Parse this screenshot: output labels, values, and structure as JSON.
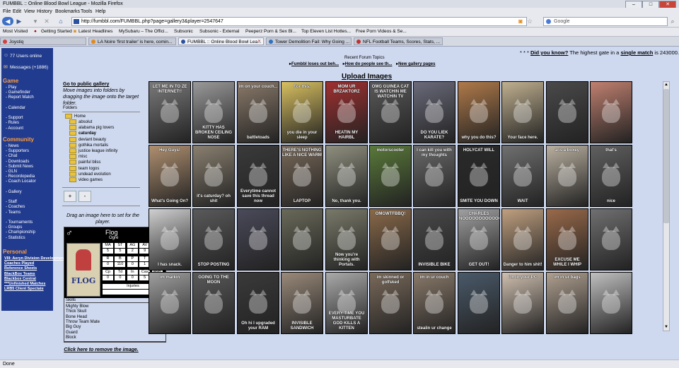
{
  "browser": {
    "title": "FUMBBL :: Online Blood Bowl League - Mozilla Firefox",
    "menu": [
      "File",
      "Edit",
      "View",
      "History",
      "Bookmarks",
      "Tools",
      "Help"
    ],
    "url": "http://fumbbl.com/FUMBBL.php?page=gallery3&player=2547647",
    "search_placeholder": "Google",
    "bookmarks": [
      "Most Visited",
      "Getting Started",
      "Latest Headlines",
      "MySubaru – The Offici...",
      "Subsonic",
      "Subsonic - External",
      "Peeperz Porn & Sex Bl...",
      "Top Eleven List Hottes...",
      "Free Porn Videos & Se..."
    ],
    "tabs": [
      {
        "label": "Joystiq",
        "active": false,
        "color": "#d04040"
      },
      {
        "label": "LA Noire 'first trailer' is here, comin...",
        "active": false,
        "color": "#e08a20"
      },
      {
        "label": "FUMBBL :: Online Blood Bowl Lea...",
        "active": true,
        "color": "#2a50a0"
      },
      {
        "label": "Tower Demolition Fail: Why Going ...",
        "active": false,
        "color": "#3070c0"
      },
      {
        "label": "NFL Football Teams, Scores, Stats, ...",
        "active": false,
        "color": "#c03030"
      }
    ],
    "status": "Done"
  },
  "sidebar": {
    "users_online": "77 Users online",
    "messages": "Messages (+1886)",
    "sections": [
      {
        "title": "Game",
        "items": [
          "- Play",
          "- Gamefinder",
          "- Report Match",
          "",
          "- Calendar",
          "",
          "- Support",
          "- Rules",
          "- Account"
        ]
      },
      {
        "title": "Community",
        "items": [
          "- News",
          "- Supporters",
          "- Chat",
          "- Downloads",
          "- Submit News",
          "- GLN",
          "- Recordopedia",
          "- Coach Locator",
          "",
          "- Gallery",
          "",
          "- Staff",
          "- Coaches",
          "- Teams",
          "",
          "- Tournaments",
          "- Groups",
          "- Championship",
          "- Statistics"
        ]
      },
      {
        "title": "Personal",
        "items": [
          "VIII: Aeryn Division Development",
          "Coaches Played",
          "Reference Sheets",
          "BlackBox Teams",
          "Blackbox Central",
          "***Unfinished Matches",
          "LRB5 Client Spectate"
        ]
      }
    ]
  },
  "top": {
    "did_you_know_prefix": "* * * ",
    "did_you_know_link": "Did you know?",
    "did_you_know_text": " The highest gate in a ",
    "single_match": "single match",
    "did_you_know_suffix": " is 243000.",
    "recent_topics": "Recent Forum Topics",
    "topic1": "Fumbbl loses out beh...",
    "topic2": "How do people see th...",
    "topic3": "New gallery pages"
  },
  "left_panel": {
    "public_gallery_link": "Go to public gallery",
    "instructions": "Move images into folders by dragging the image onto the target folder.",
    "folders_label": "Folders",
    "home": "Home",
    "folders": [
      "absolut",
      "alabama pig lovers",
      "caturday",
      "deviant beauty",
      "gothika mortalis",
      "justice league infinity",
      "misc",
      "painful bliss",
      "team logos",
      "undead evolution",
      "video games"
    ],
    "add_btn": "+",
    "remove_btn": "-",
    "drag_hint": "Drag an image here to set for the player.",
    "click_remove": "Click here to remove the image."
  },
  "player_card": {
    "name": "Flog",
    "position": "Ogre",
    "number": "#1",
    "stats_headers": [
      "MA",
      "ST",
      "AG",
      "AV",
      "G"
    ],
    "stats_values": [
      "5",
      "5",
      "2",
      "9",
      "33"
    ],
    "spp_headers": [
      "R",
      "B",
      "P",
      "T",
      "S"
    ],
    "spp_values": [
      "0",
      "110",
      "0",
      "1",
      "30"
    ],
    "extra_headers": [
      "Cp",
      "Td",
      "In",
      "Cas",
      "Mvp"
    ],
    "extra_values": [
      "0",
      "0",
      "0",
      "5",
      "4"
    ],
    "injuries_label": "Injuries",
    "skills_label": "Skills",
    "skills": [
      "Mighty Blow",
      "Thick Skull",
      "Bone Head",
      "Throw Team Mate",
      "Big Guy",
      "Guard",
      "Block"
    ],
    "box_art": "FLOG"
  },
  "upload": {
    "title": "Upload Images"
  },
  "gallery": [
    {
      "top": "LET ME IN TO ZE INTERNET!!",
      "bot": "",
      "color": "#7a7a7a"
    },
    {
      "top": "",
      "bot": "KITTY HAS BROKEN CEILING NOSE",
      "color": "#9a9a9a"
    },
    {
      "top": "im on your couch...",
      "bot": "battletoads",
      "color": "#8a7a6a"
    },
    {
      "top": "For this,",
      "bot": "you die in your sleep",
      "color": "#d8c060"
    },
    {
      "top": "MOM UR BRZAKTORZ",
      "bot": "HEATIN MY HAIRBL",
      "color": "#a03030"
    },
    {
      "top": "OMG GUINEA CAT IS WATCHIN ME WATCHIN TV",
      "bot": "",
      "color": "#5a5a5a"
    },
    {
      "top": "",
      "bot": "DO YOU LIEK KARATE?",
      "color": "#6a6a7a"
    },
    {
      "top": "",
      "bot": "why you do this?",
      "color": "#b07a4a"
    },
    {
      "top": "",
      "bot": "Your face here.",
      "color": "#c0b090"
    },
    {
      "top": "",
      "bot": "",
      "color": "#4a4a4a"
    },
    {
      "top": "",
      "bot": "",
      "color": "#c08070"
    },
    {
      "top": "Hey Guys!",
      "bot": "What's Going On?",
      "color": "#b09070"
    },
    {
      "top": "",
      "bot": "it's caturday? oh shit",
      "color": "#8a8070"
    },
    {
      "top": "",
      "bot": "Everytime cannot save this thread now",
      "color": "#3a3a3a"
    },
    {
      "top": "THERE'S NOTHING LIKE A NICE WARM",
      "bot": "LAPTOP",
      "color": "#7a6a5a"
    },
    {
      "top": "",
      "bot": "No, thank you.",
      "color": "#909080"
    },
    {
      "top": "motorscooter",
      "bot": "",
      "color": "#5a7a3a"
    },
    {
      "top": "I can kill you with my thoughts",
      "bot": "",
      "color": "#6a6a6a"
    },
    {
      "top": "HOLYCAT WILL",
      "bot": "SMITE YOU DOWN",
      "color": "#2a2a2a"
    },
    {
      "top": "",
      "bot": "WAIT",
      "color": "#707070"
    },
    {
      "top": "a is a boxey",
      "bot": "",
      "color": "#bab0a0"
    },
    {
      "top": "that's",
      "bot": "nice",
      "color": "#606060"
    },
    {
      "top": "",
      "bot": "I has snack.",
      "color": "#d0d0d0"
    },
    {
      "top": "",
      "bot": "STOP POSTING",
      "color": "#5a5a5a"
    },
    {
      "top": "",
      "bot": "",
      "color": "#4a4a5a"
    },
    {
      "top": "",
      "bot": "",
      "color": "#6a6a5a"
    },
    {
      "top": "",
      "bot": "Now you're thinking with Portals.",
      "color": "#7a7a6a"
    },
    {
      "top": "OMGWTFBBQ!",
      "bot": "",
      "color": "#8a6a4a"
    },
    {
      "top": "",
      "bot": "INVISIBLE BIKE",
      "color": "#4a4a4a"
    },
    {
      "top": "CHARLES NOOOOOOOOOOOO!",
      "bot": "GET OUT!",
      "color": "#a0a0a0"
    },
    {
      "top": "",
      "bot": "Danger to him shit!",
      "color": "#c0a080"
    },
    {
      "top": "",
      "bot": "EXCUSE ME WHILE I WHIP",
      "color": "#9a6a4a"
    },
    {
      "top": "",
      "bot": "",
      "color": "#707070"
    },
    {
      "top": "im markin",
      "bot": "",
      "color": "#a0a0a0"
    },
    {
      "top": "GOING TO THE MOON",
      "bot": "",
      "color": "#5a5a5a"
    },
    {
      "top": "",
      "bot": "Oh hi I upgraded your RAM",
      "color": "#3a3a3a"
    },
    {
      "top": "",
      "bot": "INVISIBLE SANDWICH",
      "color": "#9a8a7a"
    },
    {
      "top": "",
      "bot": "EVERY TIME YOU MASTURBATE GOD KILLS A KITTEN",
      "color": "#aaaaaa"
    },
    {
      "top": "im skinned or golfsked",
      "bot": "",
      "color": "#7a6a5a"
    },
    {
      "top": "im in ur couch",
      "bot": "stealin ur change",
      "color": "#8a7a6a"
    },
    {
      "top": "",
      "bot": "",
      "color": "#4a5a6a"
    },
    {
      "top": "I'm in your PC",
      "bot": "",
      "color": "#d0c0b0"
    },
    {
      "top": "im in ur bags",
      "bot": "",
      "color": "#b0a090"
    },
    {
      "top": "",
      "bot": "",
      "color": "#c0c0c0"
    }
  ]
}
